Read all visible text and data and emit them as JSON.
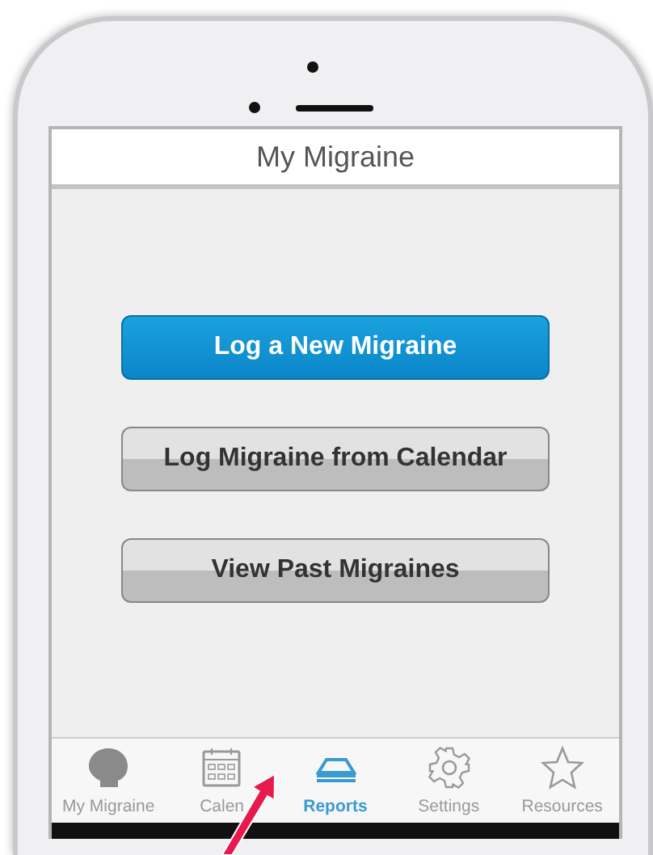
{
  "header": {
    "title": "My Migraine"
  },
  "buttons": [
    {
      "label": "Log a New Migraine",
      "kind": "primary"
    },
    {
      "label": "Log Migraine from Calendar",
      "kind": "secondary"
    },
    {
      "label": "View Past Migraines",
      "kind": "secondary"
    }
  ],
  "tab_bar": [
    {
      "label": "My Migraine",
      "kind": "head",
      "selected": false
    },
    {
      "label": "Calen",
      "kind": "calendar",
      "selected": false
    },
    {
      "label": "Reports",
      "kind": "tray",
      "selected": true
    },
    {
      "label": "Settings",
      "kind": "gear",
      "selected": false
    },
    {
      "label": "Resources",
      "kind": "star",
      "selected": false
    }
  ]
}
